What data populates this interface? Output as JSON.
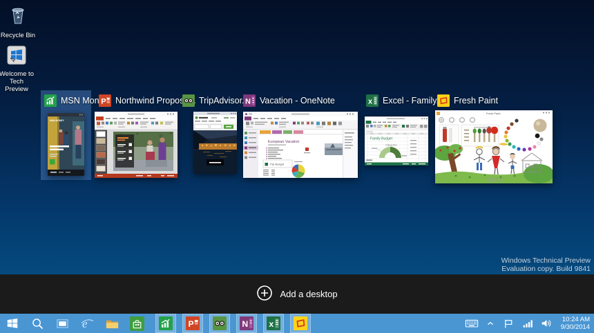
{
  "desktop": {
    "icons": {
      "recycle_bin": {
        "label": "Recycle Bin"
      },
      "welcome": {
        "label_line1": "Welcome to",
        "label_line2": "Tech Preview"
      }
    },
    "watermark": {
      "line1": "Windows Technical Preview",
      "line2": "Evaluation copy. Build 9841"
    }
  },
  "task_view": {
    "add_desktop_label": "Add a desktop",
    "tiles": [
      {
        "title": "MSN Mon...",
        "app": "MSN Money",
        "selected": true
      },
      {
        "title": "Northwind Proposa...",
        "app": "PowerPoint",
        "selected": false
      },
      {
        "title": "TripAdvisor...",
        "app": "TripAdvisor",
        "selected": false
      },
      {
        "title": "Vacation - OneNote",
        "app": "OneNote",
        "selected": false
      },
      {
        "title": "Excel - Family...",
        "app": "Excel",
        "selected": false
      },
      {
        "title": "Fresh Paint",
        "app": "Fresh Paint",
        "selected": false
      }
    ],
    "thumbnail_text": {
      "msn_masthead": "MSN MONEY",
      "onenote_heading": "European Vacation",
      "onenote_budget_title": "Trip Budget",
      "excel_sheet_title": "Family Budget",
      "excel_chart_label": "Categories",
      "freshpaint_window_title": "Fresh Paint"
    }
  },
  "taskbar": {
    "tray": {
      "time": "10:24 AM",
      "date": "9/30/2014"
    },
    "icons": [
      "start",
      "search",
      "task-view",
      "internet-explorer",
      "file-explorer",
      "store",
      "msn-money",
      "powerpoint",
      "tripadvisor",
      "onenote",
      "excel",
      "fresh-paint",
      "touch-keyboard",
      "show-hidden",
      "action-center-flag",
      "network",
      "volume"
    ]
  },
  "colors": {
    "taskbar_blue": "#4a96d3",
    "selected_tile_highlight": "#567fb8",
    "wallpaper_top": "#030f26",
    "wallpaper_bottom": "#054a7e",
    "add_desktop_bar": "#1b1b1b",
    "msn_money_green": "#23a24a",
    "powerpoint_orange": "#d04526",
    "tripadvisor_green": "#579542",
    "onenote_purple": "#80397b",
    "excel_green": "#1e7145",
    "fresh_paint_yellow": "#ffd21a",
    "fresh_paint_red": "#d4411a"
  }
}
